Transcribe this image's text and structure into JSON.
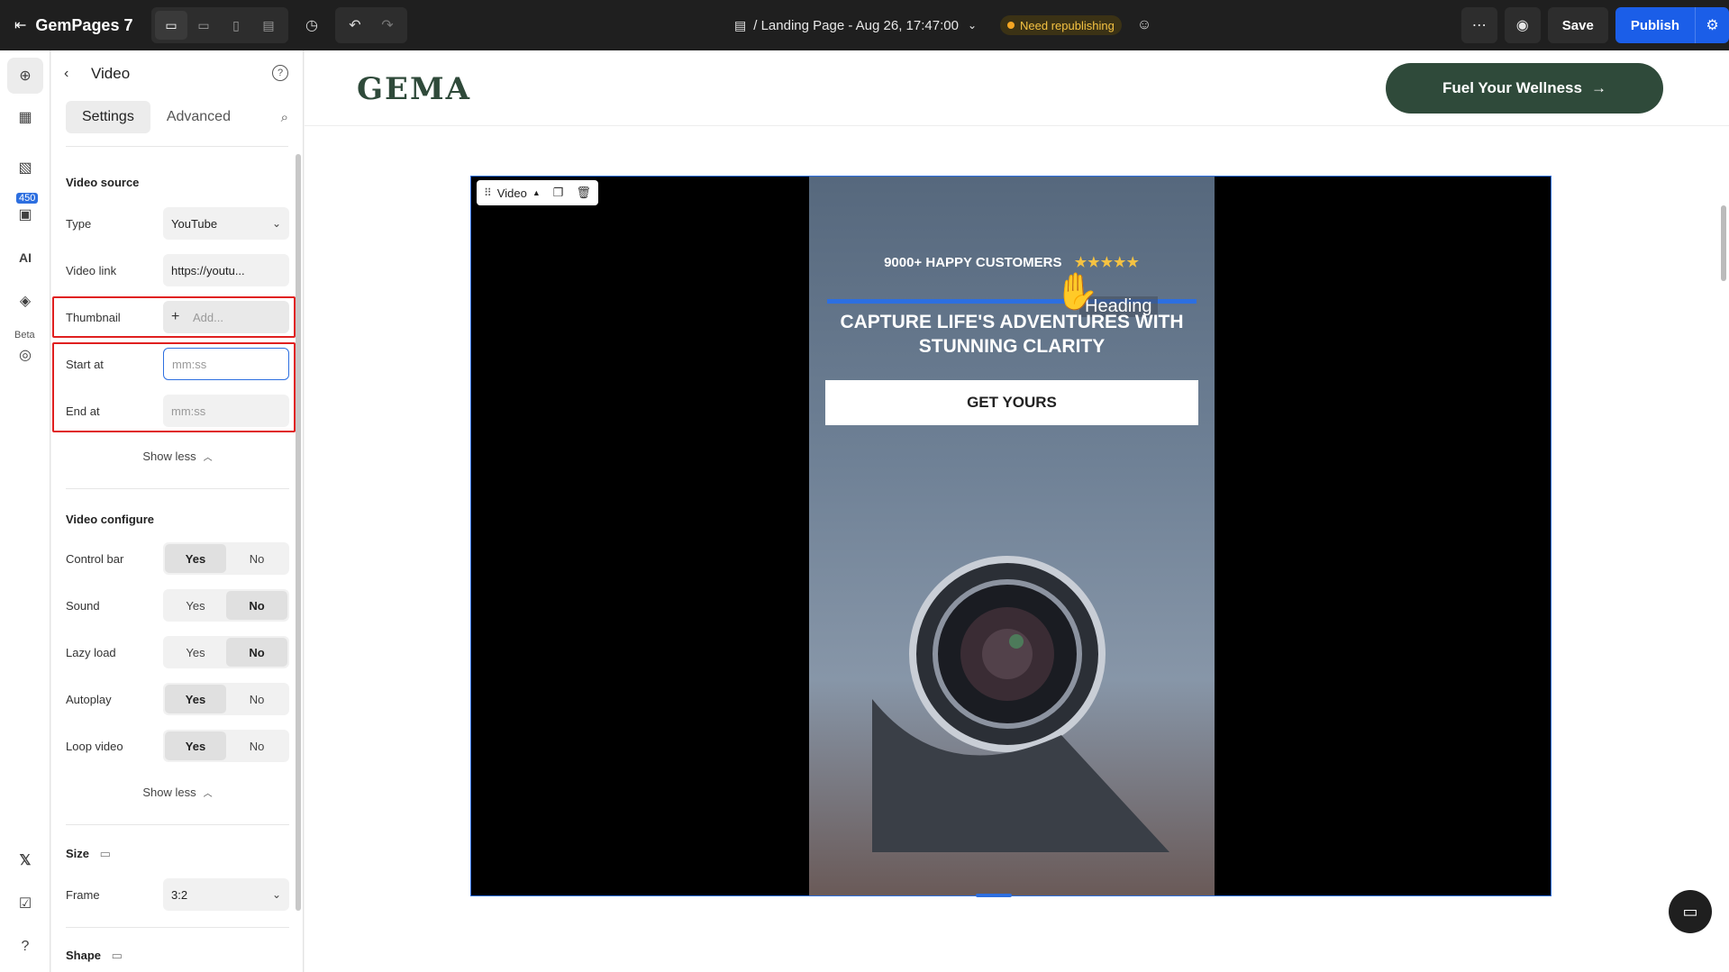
{
  "topbar": {
    "brand": "GemPages 7",
    "page_title": "/ Landing Page - Aug 26, 17:47:00",
    "status_badge": "Need republishing",
    "save_label": "Save",
    "publish_label": "Publish"
  },
  "rail": {
    "count_badge": "450",
    "ai_label": "AI",
    "beta_label": "Beta"
  },
  "panel": {
    "title": "Video",
    "tabs": [
      "Settings",
      "Advanced"
    ],
    "video_source": {
      "title": "Video source",
      "type_label": "Type",
      "type_value": "YouTube",
      "link_label": "Video link",
      "link_value": "https://youtu...",
      "thumbnail_label": "Thumbnail",
      "thumbnail_placeholder": "Add...",
      "start_label": "Start at",
      "start_placeholder": "mm:ss",
      "end_label": "End at",
      "end_placeholder": "mm:ss",
      "show_less": "Show less"
    },
    "video_configure": {
      "title": "Video configure",
      "yes": "Yes",
      "no": "No",
      "rows": [
        {
          "label": "Control bar",
          "selected": "Yes"
        },
        {
          "label": "Sound",
          "selected": "No"
        },
        {
          "label": "Lazy load",
          "selected": "No"
        },
        {
          "label": "Autoplay",
          "selected": "Yes"
        },
        {
          "label": "Loop video",
          "selected": "Yes"
        }
      ],
      "show_less": "Show less"
    },
    "size": {
      "title": "Size",
      "frame_label": "Frame",
      "frame_value": "3:2"
    },
    "shape": {
      "title": "Shape"
    }
  },
  "canvas": {
    "logo": "GEMA",
    "cta_label": "Fuel Your Wellness",
    "video_tag": "Video",
    "video_content": {
      "customers": "9000+ HAPPY CUSTOMERS",
      "stars": "★★★★★",
      "heading_tag": "Heading",
      "headline_line1": "CAPTURE LIFE'S ADVENTURES WITH",
      "headline_line2": "STUNNING CLARITY",
      "button": "GET YOURS"
    }
  }
}
